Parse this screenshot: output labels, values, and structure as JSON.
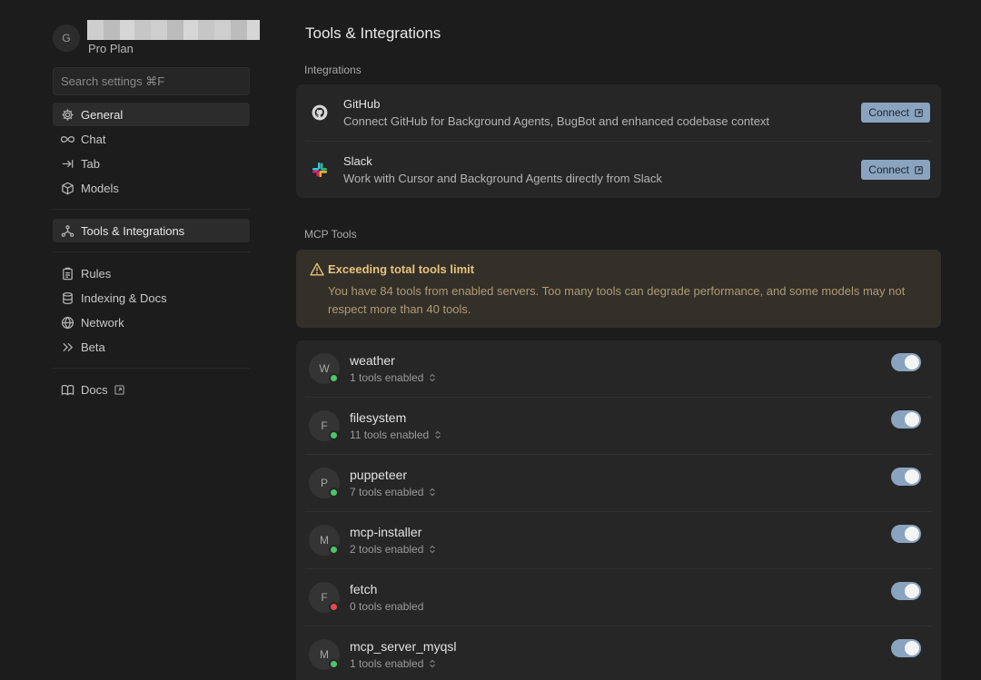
{
  "sidebar": {
    "avatar_initial": "G",
    "plan": "Pro Plan",
    "search": {
      "placeholder": "Search settings ⌘F"
    },
    "groups": [
      [
        {
          "label": "General",
          "icon": "gear-icon",
          "active": true
        },
        {
          "label": "Chat",
          "icon": "infinity-icon",
          "active": false
        },
        {
          "label": "Tab",
          "icon": "tab-arrow-icon",
          "active": false
        },
        {
          "label": "Models",
          "icon": "cube-icon",
          "active": false
        }
      ],
      [
        {
          "label": "Tools & Integrations",
          "icon": "network-nodes-icon",
          "active": true
        }
      ],
      [
        {
          "label": "Rules",
          "icon": "clipboard-icon",
          "active": false
        },
        {
          "label": "Indexing & Docs",
          "icon": "database-icon",
          "active": false
        },
        {
          "label": "Network",
          "icon": "globe-icon",
          "active": false
        },
        {
          "label": "Beta",
          "icon": "double-chevron-icon",
          "active": false
        }
      ],
      [
        {
          "label": "Docs",
          "icon": "book-icon",
          "active": false,
          "external": true
        }
      ]
    ]
  },
  "main": {
    "title": "Tools & Integrations",
    "integrations_label": "Integrations",
    "integrations": [
      {
        "name": "GitHub",
        "description": "Connect GitHub for Background Agents, BugBot and enhanced codebase context",
        "button": "Connect",
        "icon": "github-icon"
      },
      {
        "name": "Slack",
        "description": "Work with Cursor and Background Agents directly from Slack",
        "button": "Connect",
        "icon": "slack-icon"
      }
    ],
    "mcp_label": "MCP Tools",
    "warning": {
      "title": "Exceeding total tools limit",
      "body": "You have 84 tools from enabled servers. Too many tools can degrade performance, and some models may not respect more than 40 tools."
    },
    "servers": [
      {
        "initial": "W",
        "name": "weather",
        "tools": "1 tools enabled",
        "status": "ok",
        "chevron": true,
        "enabled": true
      },
      {
        "initial": "F",
        "name": "filesystem",
        "tools": "11 tools enabled",
        "status": "ok",
        "chevron": true,
        "enabled": true
      },
      {
        "initial": "P",
        "name": "puppeteer",
        "tools": "7 tools enabled",
        "status": "ok",
        "chevron": true,
        "enabled": true
      },
      {
        "initial": "M",
        "name": "mcp-installer",
        "tools": "2 tools enabled",
        "status": "ok",
        "chevron": true,
        "enabled": true
      },
      {
        "initial": "F",
        "name": "fetch",
        "tools": "0 tools enabled",
        "status": "error",
        "chevron": false,
        "enabled": true
      },
      {
        "initial": "M",
        "name": "mcp_server_myqsl",
        "tools": "1 tools enabled",
        "status": "ok",
        "chevron": true,
        "enabled": true
      }
    ]
  },
  "colors": {
    "accent": "#8aa4bf",
    "status_ok": "#4cc46b",
    "status_error": "#e5484d",
    "warning_text": "#e8c27a"
  }
}
